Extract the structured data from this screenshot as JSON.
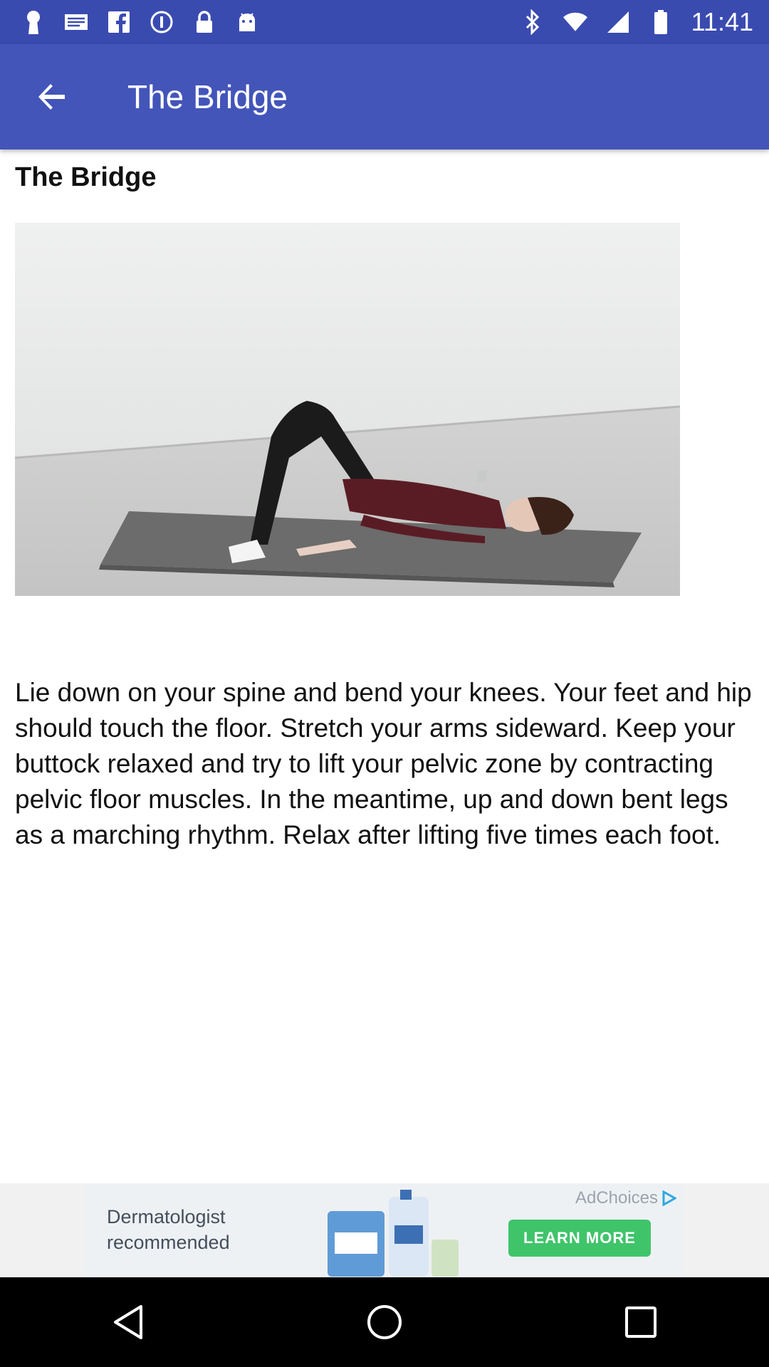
{
  "status_bar": {
    "time": "11:41",
    "left_icons": [
      "keyhole-icon",
      "mail-icon",
      "facebook-icon",
      "info-icon",
      "lock-icon",
      "android-icon"
    ],
    "right_icons": [
      "bluetooth-icon",
      "wifi-icon",
      "signal-icon",
      "battery-icon"
    ]
  },
  "app_bar": {
    "title": "The Bridge",
    "back_icon": "arrow-back-icon",
    "color": "#4355b9"
  },
  "content": {
    "title": "The Bridge",
    "description": "Lie down on your spine and bend your knees. Your feet and hip should touch the floor. Stretch your arms sideward. Keep your buttock relaxed and try to lift your pelvic zone by contracting pelvic floor muscles. In the meantime, up and down bent legs as a marching rhythm. Relax after lifting five times each foot."
  },
  "ad": {
    "text_line1": "Dermatologist",
    "text_line2": "recommended",
    "ad_choices": "AdChoices",
    "cta": "LEARN MORE",
    "cta_color": "#3fc46a"
  },
  "nav_bar": {
    "buttons": [
      "back-triangle-icon",
      "home-circle-icon",
      "recents-square-icon"
    ]
  }
}
